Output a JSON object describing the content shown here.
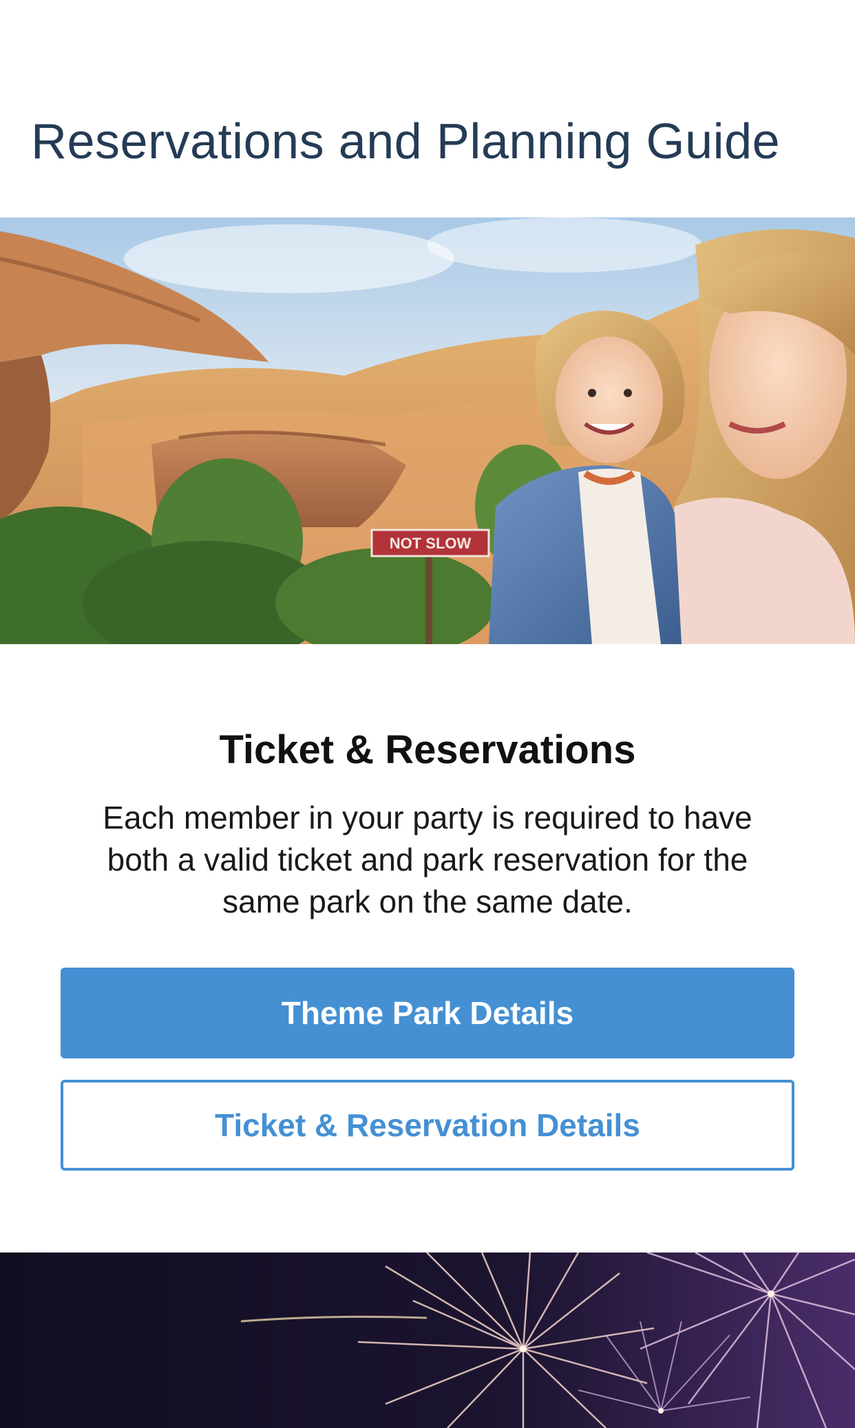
{
  "header": {
    "title": "Reservations and Planning Guide"
  },
  "hero": {
    "image_icon": "family-photo-image",
    "sign_text": "NOT SLOW"
  },
  "tickets_section": {
    "heading": "Ticket & Reservations",
    "body": "Each member in your party is required to have both a valid ticket and park reservation for the same park on the same date.",
    "primary_button_label": "Theme Park Details",
    "secondary_button_label": "Ticket & Reservation Details"
  },
  "banner": {
    "image_icon": "fireworks-image"
  },
  "colors": {
    "title_text": "#253b56",
    "accent_blue": "#4590d3",
    "banner_background": "#120f22"
  }
}
